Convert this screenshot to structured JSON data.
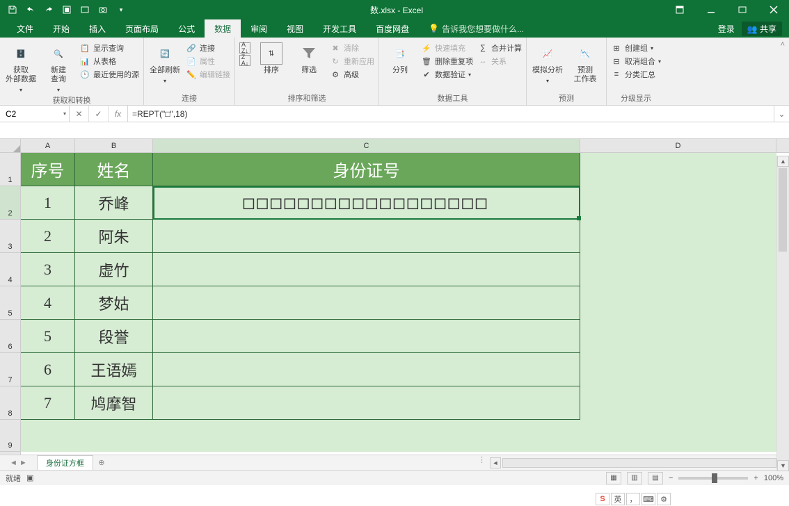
{
  "title": "数.xlsx - Excel",
  "qat": [
    "save",
    "undo",
    "redo",
    "touch",
    "new",
    "open",
    "camera"
  ],
  "menu": {
    "tabs": [
      "文件",
      "开始",
      "插入",
      "页面布局",
      "公式",
      "数据",
      "审阅",
      "视图",
      "开发工具",
      "百度网盘"
    ],
    "active_index": 5,
    "tellme": "告诉我您想要做什么...",
    "login": "登录",
    "share": "共享"
  },
  "ribbon": {
    "groups": [
      {
        "label": "获取和转换",
        "big": [
          {
            "t": "获取\n外部数据"
          },
          {
            "t": "新建\n查询"
          }
        ],
        "small": [
          "显示查询",
          "从表格",
          "最近使用的源"
        ]
      },
      {
        "label": "连接",
        "big": [
          {
            "t": "全部刷新"
          }
        ],
        "small": [
          "连接",
          "属性",
          "编辑链接"
        ]
      },
      {
        "label": "排序和筛选",
        "big": [
          {
            "t": "排序"
          },
          {
            "t": "筛选"
          }
        ],
        "small": [
          "清除",
          "重新应用",
          "高级"
        ],
        "az": true
      },
      {
        "label": "数据工具",
        "big": [
          {
            "t": "分列"
          }
        ],
        "small": [
          "快速填充",
          "删除重复项",
          "数据验证"
        ],
        "right": [
          "合并计算",
          "关系"
        ]
      },
      {
        "label": "预测",
        "big": [
          {
            "t": "模拟分析"
          },
          {
            "t": "预测\n工作表"
          }
        ],
        "small": []
      },
      {
        "label": "分级显示",
        "big": [],
        "small": [
          "创建组",
          "取消组合",
          "分类汇总"
        ]
      }
    ]
  },
  "name_box": "C2",
  "formula": "=REPT(\"□\",18)",
  "columns": [
    "A",
    "B",
    "C",
    "D"
  ],
  "row_numbers": [
    "1",
    "2",
    "3",
    "4",
    "5",
    "6",
    "7",
    "8",
    "9"
  ],
  "header_row": {
    "A": "序号",
    "B": "姓名",
    "C": "身份证号"
  },
  "rows": [
    {
      "A": "1",
      "B": "乔峰",
      "C": "□□□□□□□□□□□□□□□□□□"
    },
    {
      "A": "2",
      "B": "阿朱",
      "C": ""
    },
    {
      "A": "3",
      "B": "虚竹",
      "C": ""
    },
    {
      "A": "4",
      "B": "梦姑",
      "C": ""
    },
    {
      "A": "5",
      "B": "段誉",
      "C": ""
    },
    {
      "A": "6",
      "B": "王语嫣",
      "C": ""
    },
    {
      "A": "7",
      "B": "鸠摩智",
      "C": ""
    }
  ],
  "sheet_tab": "身份证方框",
  "status": {
    "ready": "就绪",
    "zoom": "100%"
  },
  "ime": {
    "s": "S",
    "lang": "英"
  }
}
